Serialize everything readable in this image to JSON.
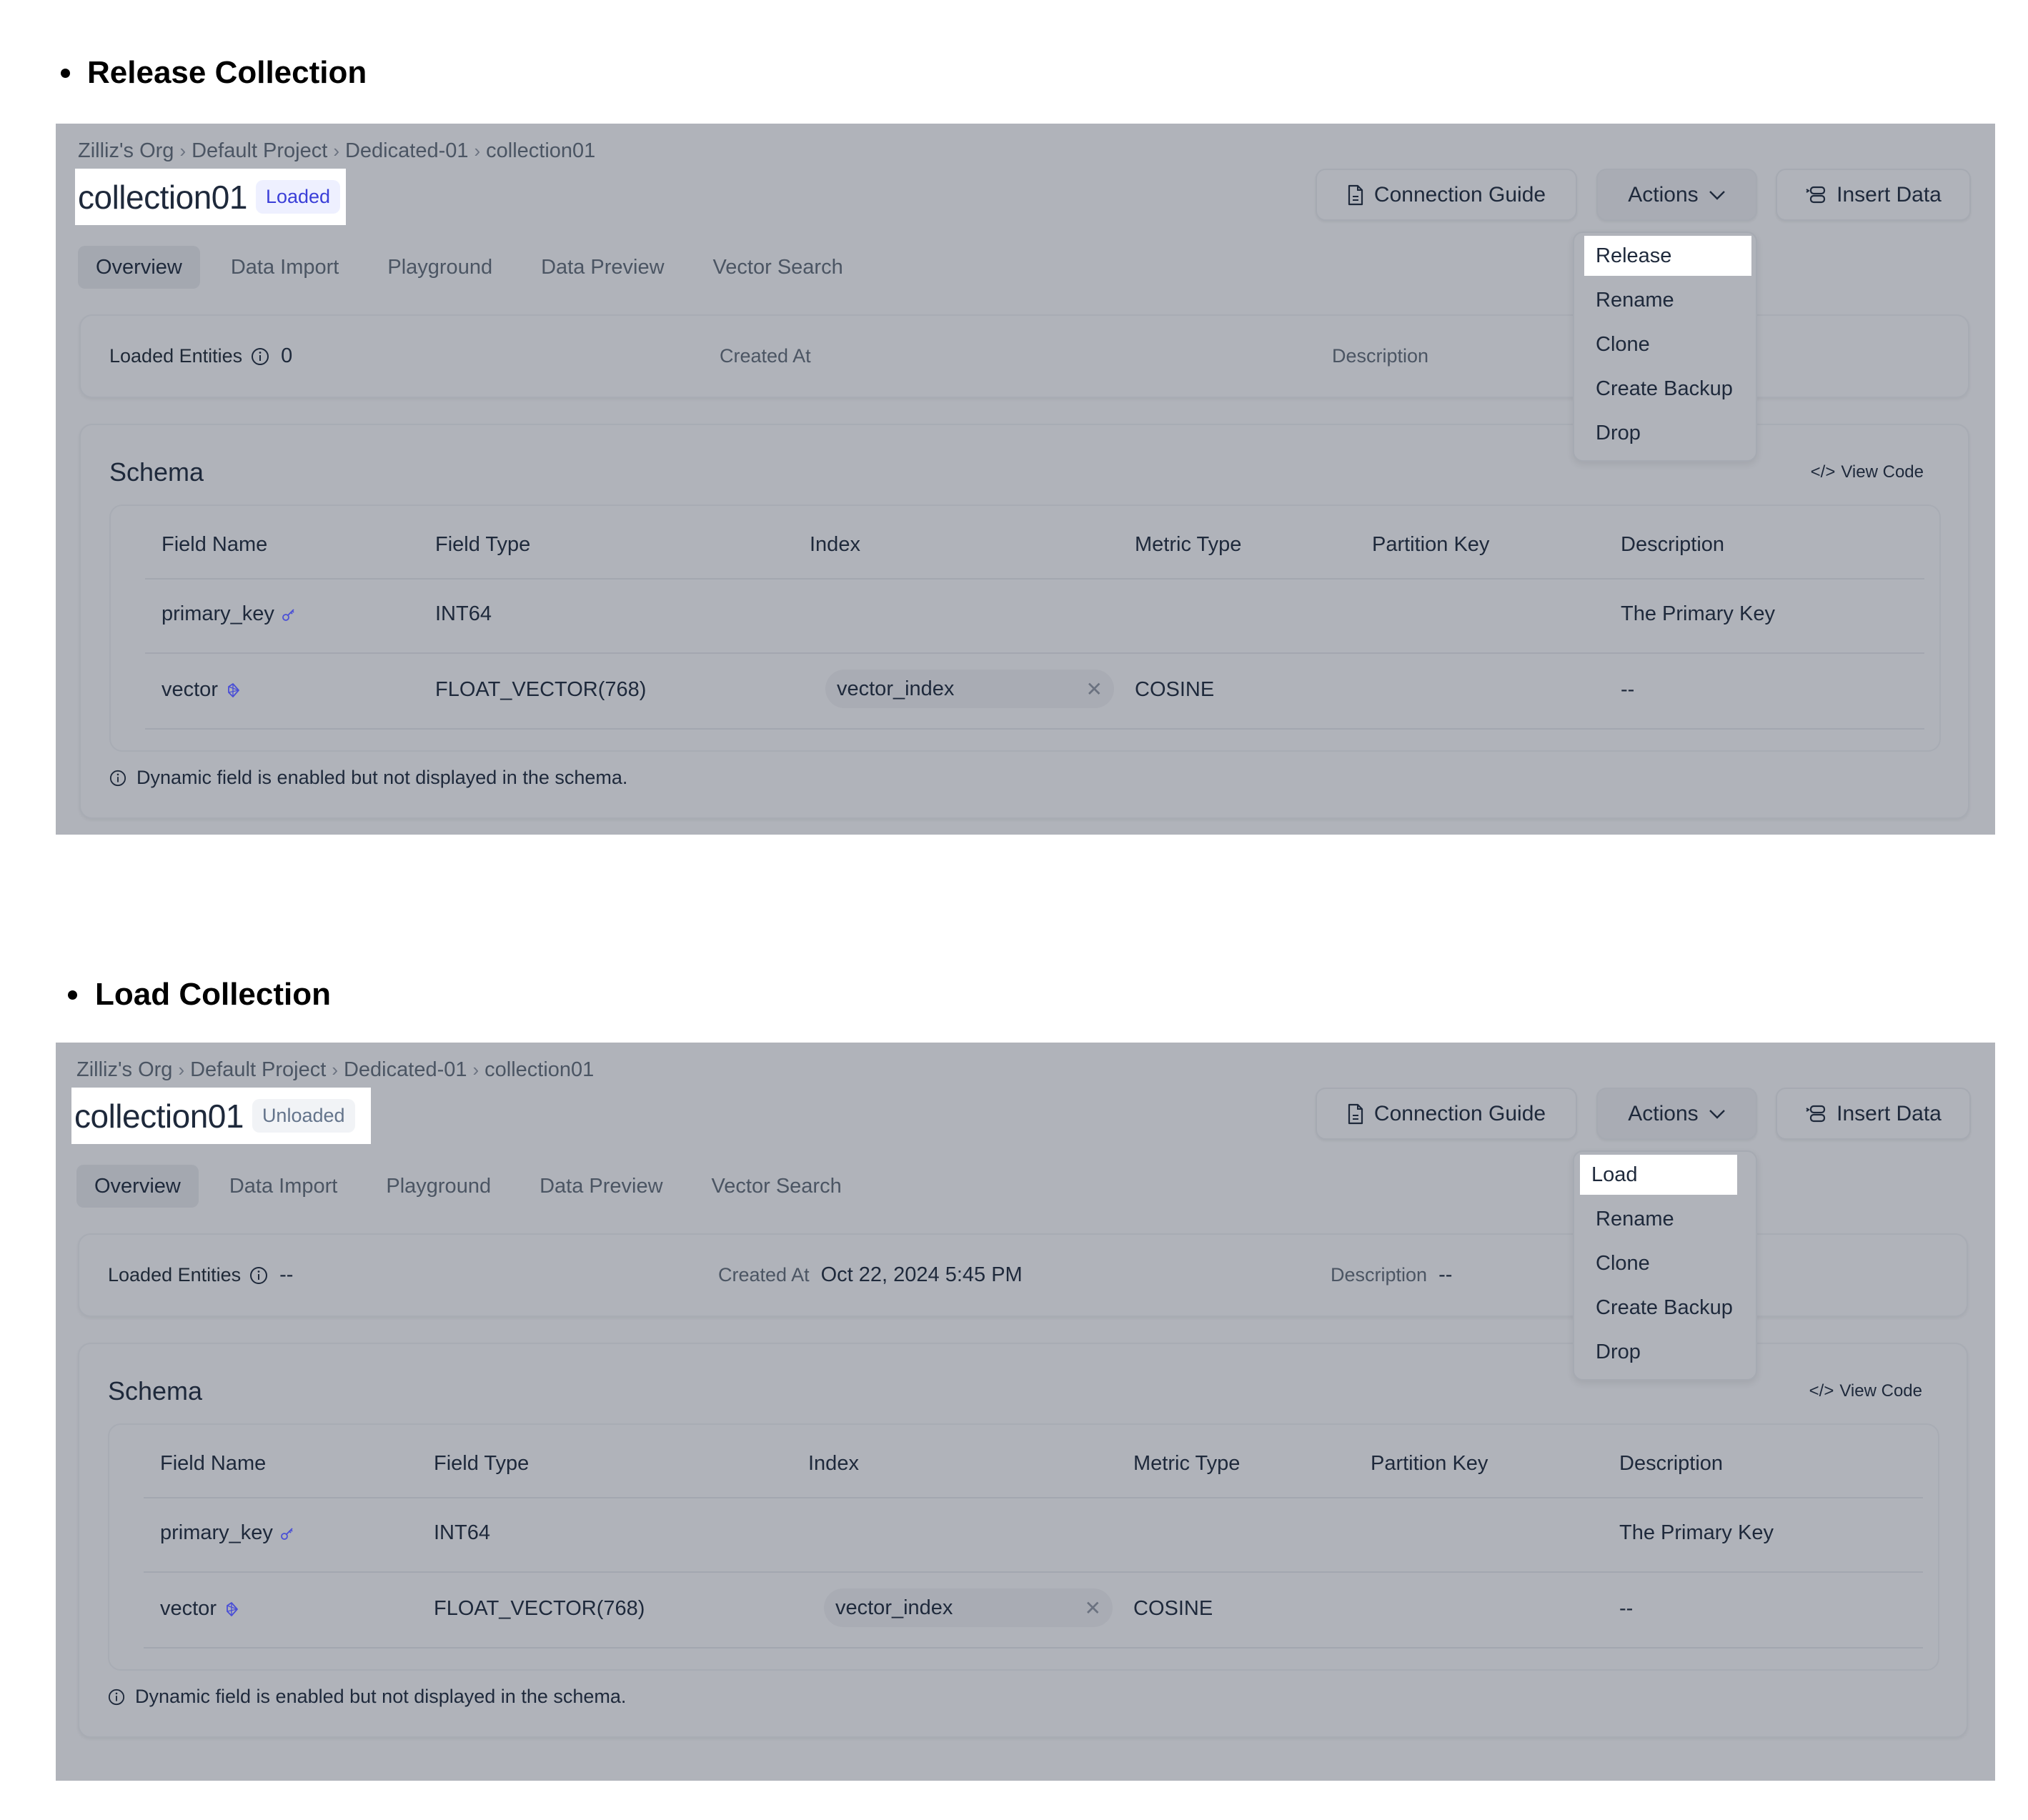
{
  "sections": [
    {
      "heading": "Release Collection",
      "breadcrumb": [
        "Zilliz's Org",
        "Default Project",
        "Dedicated-01",
        "collection01"
      ],
      "title": "collection01",
      "status_badge": "Loaded",
      "buttons": {
        "connection_guide": "Connection Guide",
        "actions": "Actions",
        "insert_data": "Insert Data"
      },
      "tabs": [
        "Overview",
        "Data Import",
        "Playground",
        "Data Preview",
        "Vector Search"
      ],
      "active_tab": "Overview",
      "info": {
        "loaded_entities_label": "Loaded Entities",
        "loaded_entities_value": "0",
        "created_at_label": "Created At",
        "created_at_value": "",
        "description_label": "Description",
        "description_value": ""
      },
      "actions_menu": [
        "Release",
        "Rename",
        "Clone",
        "Create Backup",
        "Drop"
      ],
      "highlighted_menu_item": "Release",
      "schema": {
        "title": "Schema",
        "view_code": "View Code",
        "columns": [
          "Field Name",
          "Field Type",
          "Index",
          "Metric Type",
          "Partition Key",
          "Description"
        ],
        "rows": [
          {
            "field_name": "primary_key",
            "icon": "key-icon",
            "field_type": "INT64",
            "index": "",
            "metric_type": "",
            "partition_key": "",
            "description": "The Primary Key"
          },
          {
            "field_name": "vector",
            "icon": "vector-icon",
            "field_type": "FLOAT_VECTOR(768)",
            "index": "vector_index",
            "metric_type": "COSINE",
            "partition_key": "",
            "description": "--"
          }
        ],
        "note": "Dynamic field is enabled but not displayed in the schema."
      }
    },
    {
      "heading": "Load Collection",
      "breadcrumb": [
        "Zilliz's Org",
        "Default Project",
        "Dedicated-01",
        "collection01"
      ],
      "title": "collection01",
      "status_badge": "Unloaded",
      "buttons": {
        "connection_guide": "Connection Guide",
        "actions": "Actions",
        "insert_data": "Insert Data"
      },
      "tabs": [
        "Overview",
        "Data Import",
        "Playground",
        "Data Preview",
        "Vector Search"
      ],
      "active_tab": "Overview",
      "info": {
        "loaded_entities_label": "Loaded Entities",
        "loaded_entities_value": "--",
        "created_at_label": "Created At",
        "created_at_value": "Oct 22, 2024 5:45 PM",
        "description_label": "Description",
        "description_value": "--"
      },
      "actions_menu": [
        "Load",
        "Rename",
        "Clone",
        "Create Backup",
        "Drop"
      ],
      "highlighted_menu_item": "Load",
      "schema": {
        "title": "Schema",
        "view_code": "View Code",
        "columns": [
          "Field Name",
          "Field Type",
          "Index",
          "Metric Type",
          "Partition Key",
          "Description"
        ],
        "rows": [
          {
            "field_name": "primary_key",
            "icon": "key-icon",
            "field_type": "INT64",
            "index": "",
            "metric_type": "",
            "partition_key": "",
            "description": "The Primary Key"
          },
          {
            "field_name": "vector",
            "icon": "vector-icon",
            "field_type": "FLOAT_VECTOR(768)",
            "index": "vector_index",
            "metric_type": "COSINE",
            "partition_key": "",
            "description": "--"
          }
        ],
        "note": "Dynamic field is enabled but not displayed in the schema."
      }
    }
  ],
  "colors": {
    "accent": "#3b3fd8",
    "overlay": "#b0b3ba",
    "highlight": "#ffffff"
  }
}
